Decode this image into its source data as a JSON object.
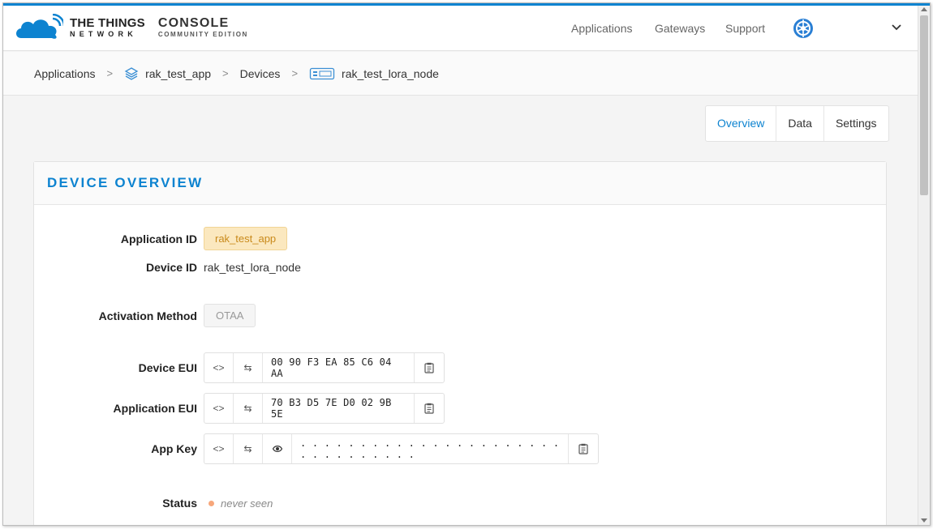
{
  "brand": {
    "ttn_line1": "THE THINGS",
    "ttn_line2": "NETWORK",
    "console_line1": "CONSOLE",
    "console_line2": "COMMUNITY EDITION",
    "accent_color": "#0d83d0"
  },
  "nav": {
    "applications": "Applications",
    "gateways": "Gateways",
    "support": "Support"
  },
  "breadcrumb": {
    "items": [
      "Applications",
      "rak_test_app",
      "Devices",
      "rak_test_lora_node"
    ],
    "separator": ">"
  },
  "tabs": [
    {
      "label": "Overview",
      "active": true
    },
    {
      "label": "Data",
      "active": false
    },
    {
      "label": "Settings",
      "active": false
    }
  ],
  "panel": {
    "title": "DEVICE OVERVIEW"
  },
  "fields": {
    "application_id_label": "Application ID",
    "application_id_value": "rak_test_app",
    "device_id_label": "Device ID",
    "device_id_value": "rak_test_lora_node",
    "activation_label": "Activation Method",
    "activation_value": "OTAA",
    "device_eui_label": "Device EUI",
    "device_eui_value": "00 90 F3 EA 85 C6 04 AA",
    "app_eui_label": "Application EUI",
    "app_eui_value": "70 B3 D5 7E D0 02 9B 5E",
    "app_key_label": "App Key",
    "app_key_value": ". . . . . . . . . . . . . . . . . . . . . . . . . . . . . . . .",
    "status_label": "Status",
    "status_value": "never seen"
  },
  "icons": {
    "code_toggle": "<>",
    "byte_swap": "⇆",
    "reveal": "eye-icon",
    "copy": "clipboard-icon"
  }
}
